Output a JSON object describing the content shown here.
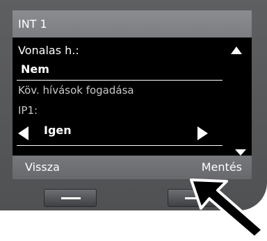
{
  "screen": {
    "title": "INT 1",
    "line_label": "Vonalas h.:",
    "line_value": "Nem",
    "accept_calls_label": "Köv. hívások fogadása",
    "ip_label": "IP1:",
    "ip_value": "Igen"
  },
  "softkeys": {
    "left": "Vissza",
    "right": "Mentés"
  },
  "colors": {
    "device_body": "#58595b",
    "header_bar": "#838487",
    "screen_bg": "#000000"
  }
}
